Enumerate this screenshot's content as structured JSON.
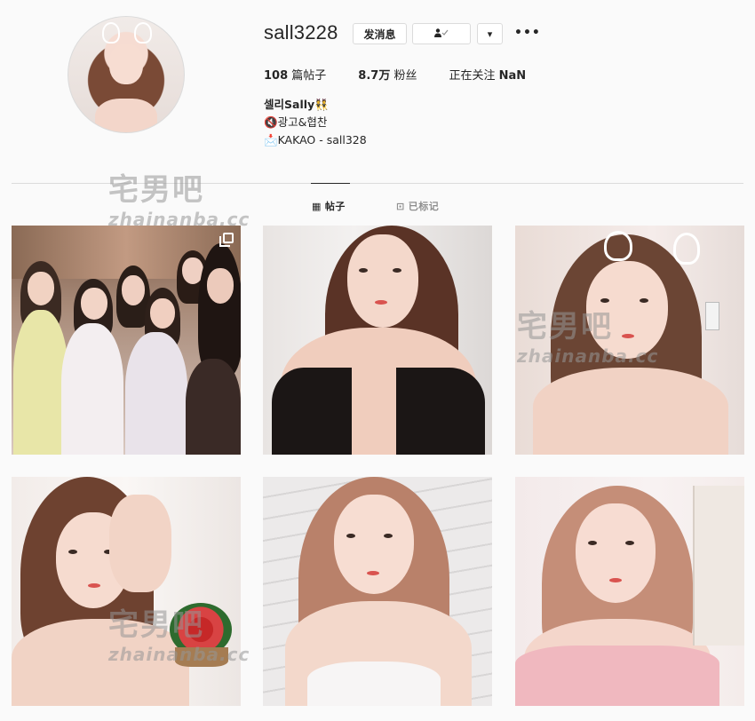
{
  "profile": {
    "username": "sall3228",
    "message_button": "发消息",
    "follow_button_icon": "person-check-icon",
    "dropdown_icon": "▾",
    "more_icon": "•••",
    "stats": {
      "posts_count": "108",
      "posts_label": "篇帖子",
      "followers_count": "8.7万",
      "followers_label": "粉丝",
      "following_label": "正在关注",
      "following_count": "NaN"
    },
    "bio": {
      "name": "셀리Sally",
      "name_emoji": "👯",
      "line2_icon": "🔇",
      "line2": "광고&협찬",
      "line3_icon": "📩",
      "line3": "KAKAO - sall328"
    }
  },
  "tabs": {
    "posts": "帖子",
    "saved": "已标记"
  },
  "watermark": {
    "cn": "宅男吧",
    "en": "zhainanba.cc"
  },
  "grid": {
    "tile_count": 6,
    "first_tile_multi": true
  }
}
